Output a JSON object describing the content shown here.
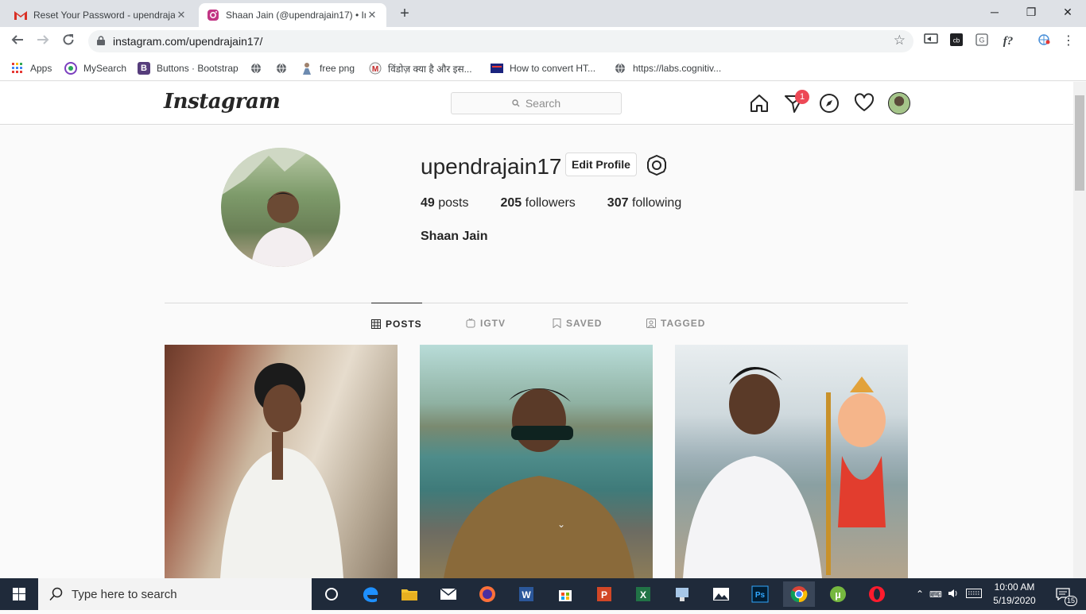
{
  "browser": {
    "tabs": [
      {
        "title": "Reset Your Password - upendraja",
        "active": false,
        "favicon": "gmail-icon"
      },
      {
        "title": "Shaan Jain (@upendrajain17) • In",
        "active": true,
        "favicon": "instagram-icon"
      }
    ],
    "url": "instagram.com/upendrajain17/",
    "bookmarks": [
      {
        "label": "Apps",
        "icon": "apps-grid-icon"
      },
      {
        "label": "MySearch",
        "icon": "mysearch-icon"
      },
      {
        "label": "Buttons · Bootstrap",
        "icon": "bootstrap-icon"
      },
      {
        "label": "",
        "icon": "globe-icon"
      },
      {
        "label": "",
        "icon": "globe-icon"
      },
      {
        "label": "free png",
        "icon": "freepng-icon"
      },
      {
        "label": "विंडोज़ क्या है और इस...",
        "icon": "site-icon"
      },
      {
        "label": "How to convert HT...",
        "icon": "site-icon"
      },
      {
        "label": "https://labs.cognitiv...",
        "icon": "globe-icon"
      }
    ]
  },
  "instagram": {
    "logo": "Instagram",
    "search_placeholder": "Search",
    "notification_count": "1",
    "profile": {
      "username": "upendrajain17",
      "edit_label": "Edit Profile",
      "posts_count": "49",
      "posts_label": "posts",
      "followers_count": "205",
      "followers_label": "followers",
      "following_count": "307",
      "following_label": "following",
      "full_name": "Shaan Jain"
    },
    "tabs": [
      {
        "label": "POSTS",
        "active": true,
        "icon": "grid-icon"
      },
      {
        "label": "IGTV",
        "active": false,
        "icon": "igtv-icon"
      },
      {
        "label": "SAVED",
        "active": false,
        "icon": "bookmark-icon"
      },
      {
        "label": "TAGGED",
        "active": false,
        "icon": "tagged-icon"
      }
    ]
  },
  "taskbar": {
    "search_placeholder": "Type here to search",
    "time": "10:00 AM",
    "date": "5/19/2020",
    "notification_count": "15"
  }
}
